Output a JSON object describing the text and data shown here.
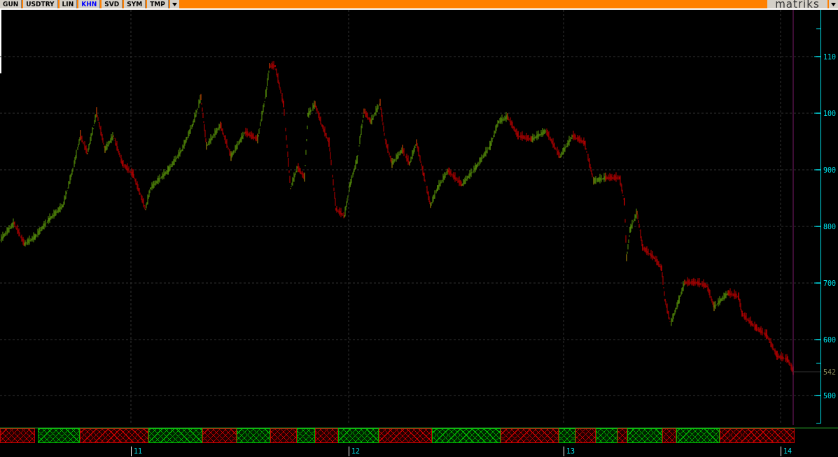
{
  "tabs": [
    {
      "label": "GUN",
      "selected": false
    },
    {
      "label": "USDTRY",
      "selected": false
    },
    {
      "label": "LIN",
      "selected": false
    },
    {
      "label": "KHN",
      "selected": true
    },
    {
      "label": "SVD",
      "selected": false
    },
    {
      "label": "SYM",
      "selected": false
    },
    {
      "label": "TMP",
      "selected": false
    }
  ],
  "logo": "matriks",
  "chart": {
    "y_axis_labels": [
      "110",
      "100",
      "900",
      "800",
      "700",
      "600",
      "500"
    ],
    "last_price": "542",
    "x_axis_labels": [
      "11",
      "12",
      "13",
      "14"
    ]
  },
  "bands": [
    {
      "kind": "down"
    },
    {
      "kind": "up"
    },
    {
      "kind": "down"
    },
    {
      "kind": "up"
    },
    {
      "kind": "down"
    },
    {
      "kind": "up"
    },
    {
      "kind": "down"
    },
    {
      "kind": "up"
    },
    {
      "kind": "down"
    },
    {
      "kind": "up"
    },
    {
      "kind": "down"
    },
    {
      "kind": "up"
    },
    {
      "kind": "down"
    },
    {
      "kind": "up"
    },
    {
      "kind": "down"
    },
    {
      "kind": "up"
    },
    {
      "kind": "down"
    },
    {
      "kind": "up"
    },
    {
      "kind": "down"
    },
    {
      "kind": "up"
    },
    {
      "kind": "down"
    }
  ]
}
